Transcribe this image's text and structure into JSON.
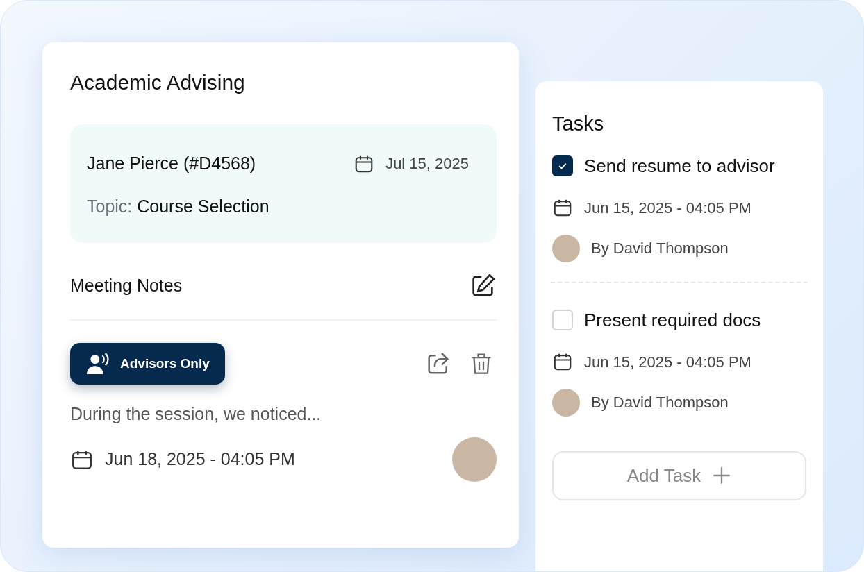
{
  "advising": {
    "title": "Academic Advising",
    "student": "Jane Pierce (#D4568)",
    "date": "Jul 15, 2025",
    "topic_label": "Topic:",
    "topic": "Course Selection"
  },
  "notes": {
    "title": "Meeting Notes",
    "badge": "Advisors Only",
    "text": "During the session, we noticed...",
    "datetime": "Jun 18, 2025 - 04:05 PM"
  },
  "tasks": {
    "title": "Tasks",
    "items": [
      {
        "title": "Send resume to advisor",
        "checked": true,
        "datetime": "Jun 15, 2025 - 04:05 PM",
        "author": "By David Thompson"
      },
      {
        "title": "Present required docs",
        "checked": false,
        "datetime": "Jun 15, 2025 - 04:05 PM",
        "author": "By David Thompson"
      }
    ],
    "add_button": "Add Task"
  }
}
